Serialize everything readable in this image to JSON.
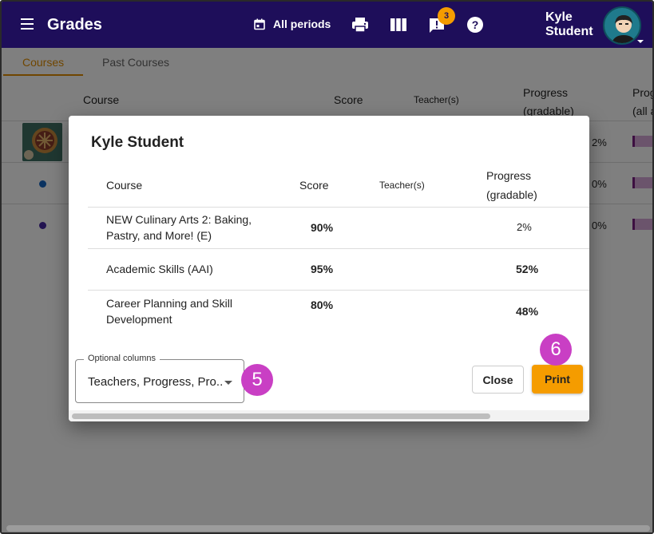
{
  "header": {
    "title": "Grades",
    "period_label": "All periods",
    "notification_count": "3",
    "user_first": "Kyle",
    "user_last": "Student"
  },
  "tabs": [
    {
      "label": "Courses",
      "active": true
    },
    {
      "label": "Past Courses",
      "active": false
    }
  ],
  "background_table": {
    "headers": {
      "course": "Course",
      "score": "Score",
      "teachers": "Teacher(s)",
      "progress_line1": "Progress",
      "progress_line2": "(gradable)",
      "progress_all_line1": "Prog",
      "progress_all_line2": "(all a"
    },
    "rows": [
      {
        "progress_all": "2%",
        "dot_color": null
      },
      {
        "progress_all": "0%",
        "dot_color": "#1565c0"
      },
      {
        "progress_all": "0%",
        "dot_color": "#4527a0"
      }
    ]
  },
  "dialog": {
    "title": "Kyle Student",
    "headers": {
      "course": "Course",
      "score": "Score",
      "teachers": "Teacher(s)",
      "progress_line1": "Progress",
      "progress_line2": "(gradable)"
    },
    "rows": [
      {
        "course_line1": "NEW Culinary Arts 2: Baking,",
        "course_line2": "Pastry, and More! (E)",
        "score": "90%",
        "progress": "2%"
      },
      {
        "course_line1": "Academic Skills (AAI)",
        "course_line2": "",
        "score": "95%",
        "progress": "52%"
      },
      {
        "course_line1": "Career Planning and Skill",
        "course_line2": "Development",
        "score": "80%",
        "progress": "48%"
      }
    ],
    "optional_columns_label": "Optional columns",
    "optional_columns_value": "Teachers, Progress, Pro...",
    "close_label": "Close",
    "print_label": "Print"
  },
  "callouts": {
    "select": "5",
    "print": "6"
  },
  "colors": {
    "header_bg": "#1e0e5a",
    "accent": "#f59c00",
    "callout": "#c93fc4",
    "progress_bar": "#d7a9d8"
  }
}
